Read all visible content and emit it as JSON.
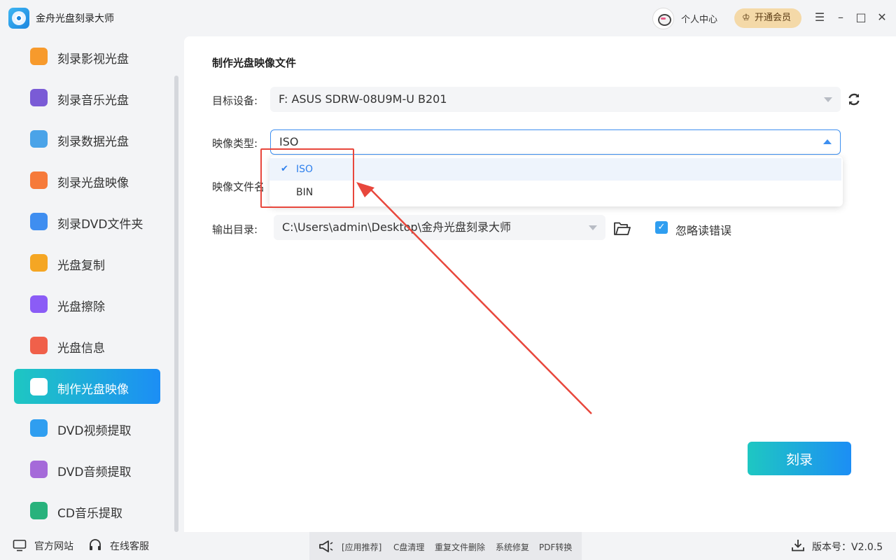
{
  "app": {
    "title": "金舟光盘刻录大师",
    "user_center": "个人中心",
    "vip_button": "开通会员"
  },
  "sidebar": {
    "items": [
      {
        "label": "刻录影视光盘",
        "color": "#f79a2c"
      },
      {
        "label": "刻录音乐光盘",
        "color": "#7a5bd6"
      },
      {
        "label": "刻录数据光盘",
        "color": "#4aa3e8"
      },
      {
        "label": "刻录光盘映像",
        "color": "#f67a3a"
      },
      {
        "label": "刻录DVD文件夹",
        "color": "#3f8ef0"
      },
      {
        "label": "光盘复制",
        "color": "#f5a623"
      },
      {
        "label": "光盘擦除",
        "color": "#8b5cf6"
      },
      {
        "label": "光盘信息",
        "color": "#f0604a"
      },
      {
        "label": "制作光盘映像",
        "color": "#2aa7e8"
      },
      {
        "label": "DVD视频提取",
        "color": "#2f9ef0"
      },
      {
        "label": "DVD音频提取",
        "color": "#a56ad9"
      },
      {
        "label": "CD音乐提取",
        "color": "#28b27c"
      }
    ],
    "active_index": 8
  },
  "main": {
    "title": "制作光盘映像文件",
    "device_label": "目标设备:",
    "device_value": "F: ASUS SDRW-08U9M-U B201",
    "type_label": "映像类型:",
    "type_value": "ISO",
    "type_options": [
      "ISO",
      "BIN"
    ],
    "filename_label": "映像文件名",
    "output_label": "输出目录:",
    "output_value": "C:\\Users\\admin\\Desktop\\金舟光盘刻录大师",
    "ignore_errors_label": "忽略读错误",
    "ignore_errors_checked": true,
    "burn_button": "刻录"
  },
  "footer": {
    "website": "官方网站",
    "support": "在线客服",
    "promo_tag": "[应用推荐]",
    "promo_items": [
      "C盘清理",
      "重复文件删除",
      "系统修复",
      "PDF转换"
    ],
    "version": "版本号：V2.0.5"
  },
  "colors": {
    "accent_start": "#1ec7c2",
    "accent_end": "#1c8ef5",
    "annotation_red": "#e8473c"
  }
}
